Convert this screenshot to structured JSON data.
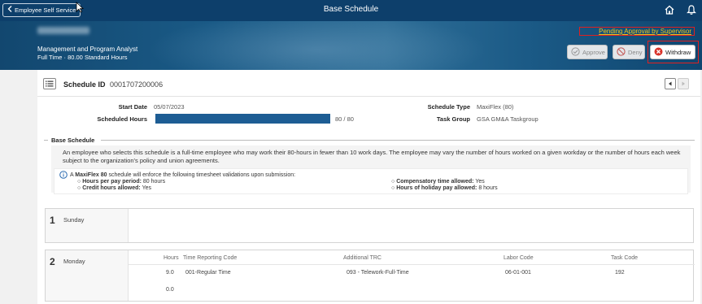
{
  "topbar": {
    "back_label": "Employee Self Service",
    "title": "Base Schedule"
  },
  "banner": {
    "job_title": "Management and Program Analyst",
    "job_hours": "Full Time · 80.00 Standard Hours",
    "status": "Pending Approval by Supervisor",
    "approve_label": "Approve",
    "deny_label": "Deny",
    "withdraw_label": "Withdraw"
  },
  "schedule": {
    "id_label": "Schedule ID",
    "id_value": "0001707200006",
    "start_date_label": "Start Date",
    "start_date_value": "05/07/2023",
    "scheduled_hours_label": "Scheduled Hours",
    "scheduled_hours_value": "80 / 80",
    "scheduled_hours_fraction": 1.0,
    "schedule_type_label": "Schedule Type",
    "schedule_type_value": "MaxiFlex (80)",
    "task_group_label": "Task Group",
    "task_group_value": "GSA GM&A Taskgroup"
  },
  "base_schedule": {
    "title": "Base Schedule",
    "description": "An employee who selects this schedule is a full-time employee who may work their 80-hours in fewer than 10 work days. The employee may vary the number of hours worked on a given workday or the number of hours each week subject to the organization's policy and union agreements.",
    "info_prefix": "A",
    "info_bold": "MaxiFlex 80",
    "info_suffix": "schedule will enforce the following timesheet validations upon submission:",
    "bullets": [
      {
        "label": "Hours per pay period:",
        "value": "80 hours"
      },
      {
        "label": "Credit hours allowed:",
        "value": "Yes"
      },
      {
        "label": "Compensatory time allowed:",
        "value": "Yes"
      },
      {
        "label": "Hours of holiday pay allowed:",
        "value": "8 hours"
      }
    ]
  },
  "days": [
    {
      "num": "1",
      "name": "Sunday"
    },
    {
      "num": "2",
      "name": "Monday"
    }
  ],
  "columns": {
    "hours": "Hours",
    "trc": "Time Reporting Code",
    "additional_trc": "Additional TRC",
    "labor_code": "Labor Code",
    "task_code": "Task Code"
  },
  "monday_rows": [
    {
      "hours": "9.0",
      "trc": "001-Regular Time",
      "additional_trc": "093 - Telework-Full-Time",
      "labor_code": "06-01-001",
      "task_code": "192"
    },
    {
      "hours": "0.0"
    }
  ],
  "colors": {
    "topbar": "#0d3f6b",
    "hours_bar": "#1d5d94",
    "status_text": "#f0c419",
    "highlight_border": "#e02020",
    "withdraw_icon": "#d9342b"
  }
}
